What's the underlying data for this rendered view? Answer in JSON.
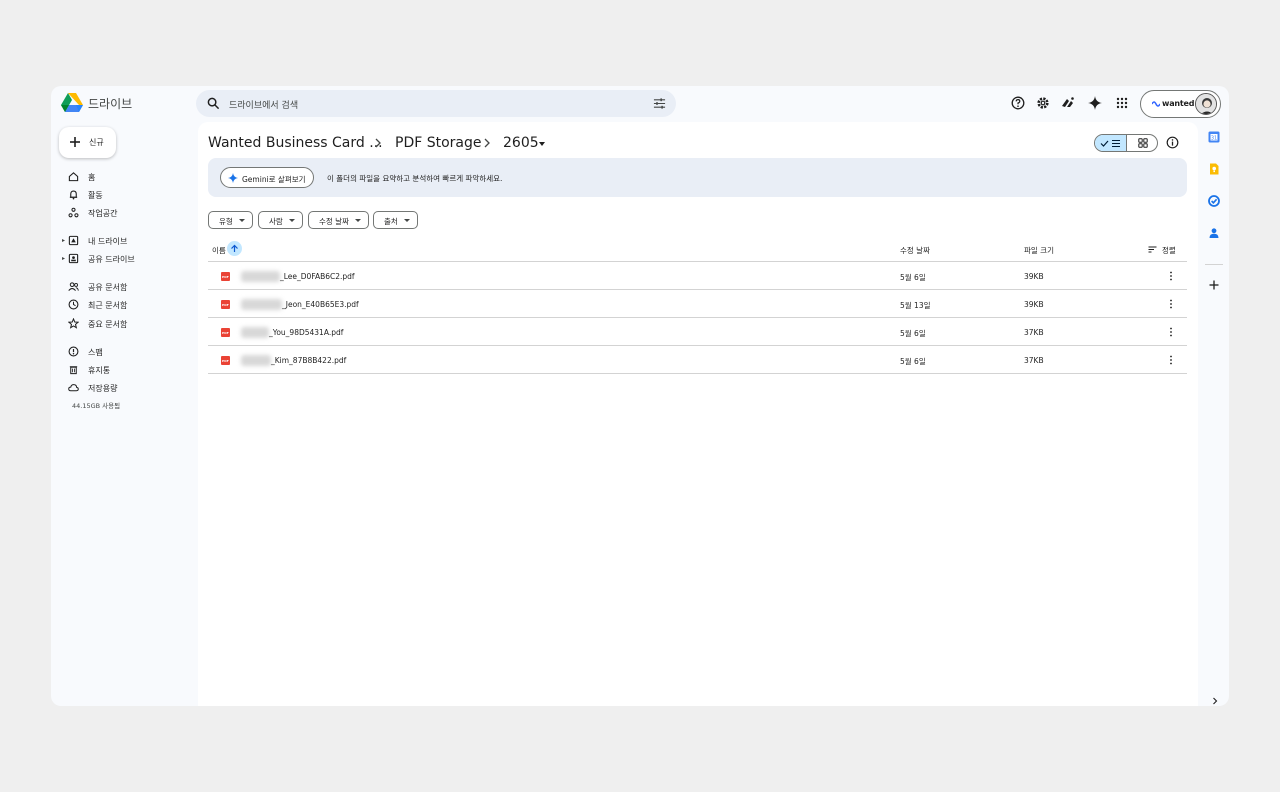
{
  "app": {
    "title": "드라이브",
    "logo_icon": "google-drive-logo"
  },
  "search": {
    "placeholder": "드라이브에서 검색"
  },
  "account": {
    "brand": "wanted"
  },
  "sidebar": {
    "new_label": "신규",
    "items": [
      {
        "label": "홈",
        "icon": "home-icon"
      },
      {
        "label": "활동",
        "icon": "bell-icon"
      },
      {
        "label": "작업공간",
        "icon": "workspaces-icon"
      },
      {
        "label": "내 드라이브",
        "icon": "my-drive-icon"
      },
      {
        "label": "공유 드라이브",
        "icon": "shared-drives-icon"
      },
      {
        "label": "공유 문서함",
        "icon": "shared-with-me-icon"
      },
      {
        "label": "최근 문서함",
        "icon": "clock-icon"
      },
      {
        "label": "중요 문서함",
        "icon": "star-icon"
      },
      {
        "label": "스팸",
        "icon": "spam-icon"
      },
      {
        "label": "휴지통",
        "icon": "trash-icon"
      },
      {
        "label": "저장용량",
        "icon": "cloud-icon"
      }
    ],
    "storage_text": "44.15GB 사용됨"
  },
  "breadcrumb": {
    "items": [
      "Wanted Business Card ...",
      "PDF Storage",
      "2605"
    ]
  },
  "gemini": {
    "button_label": "Gemini로 살펴보기",
    "description": "이 폴더의 파일을 요약하고 분석하여 빠르게 파악하세요."
  },
  "filters": [
    "유형",
    "사람",
    "수정 날짜",
    "출처"
  ],
  "table": {
    "columns": {
      "name": "이름",
      "modified": "수정 날짜",
      "size": "파일 크기",
      "sort": "정렬"
    },
    "rows": [
      {
        "name": "_Lee_D0FAB6C2.pdf",
        "modified": "5월 6일",
        "size": "39KB"
      },
      {
        "name": "_Jeon_E40B65E3.pdf",
        "modified": "5월 13일",
        "size": "39KB"
      },
      {
        "name": "_You_98D5431A.pdf",
        "modified": "5월 6일",
        "size": "37KB"
      },
      {
        "name": "_Kim_87B8B422.pdf",
        "modified": "5월 6일",
        "size": "37KB"
      }
    ]
  },
  "colors": {
    "accent": "#0b57d0",
    "selected_bg": "#c2e7ff",
    "surface": "#f8fafd",
    "pdf_red": "#ea4335"
  }
}
